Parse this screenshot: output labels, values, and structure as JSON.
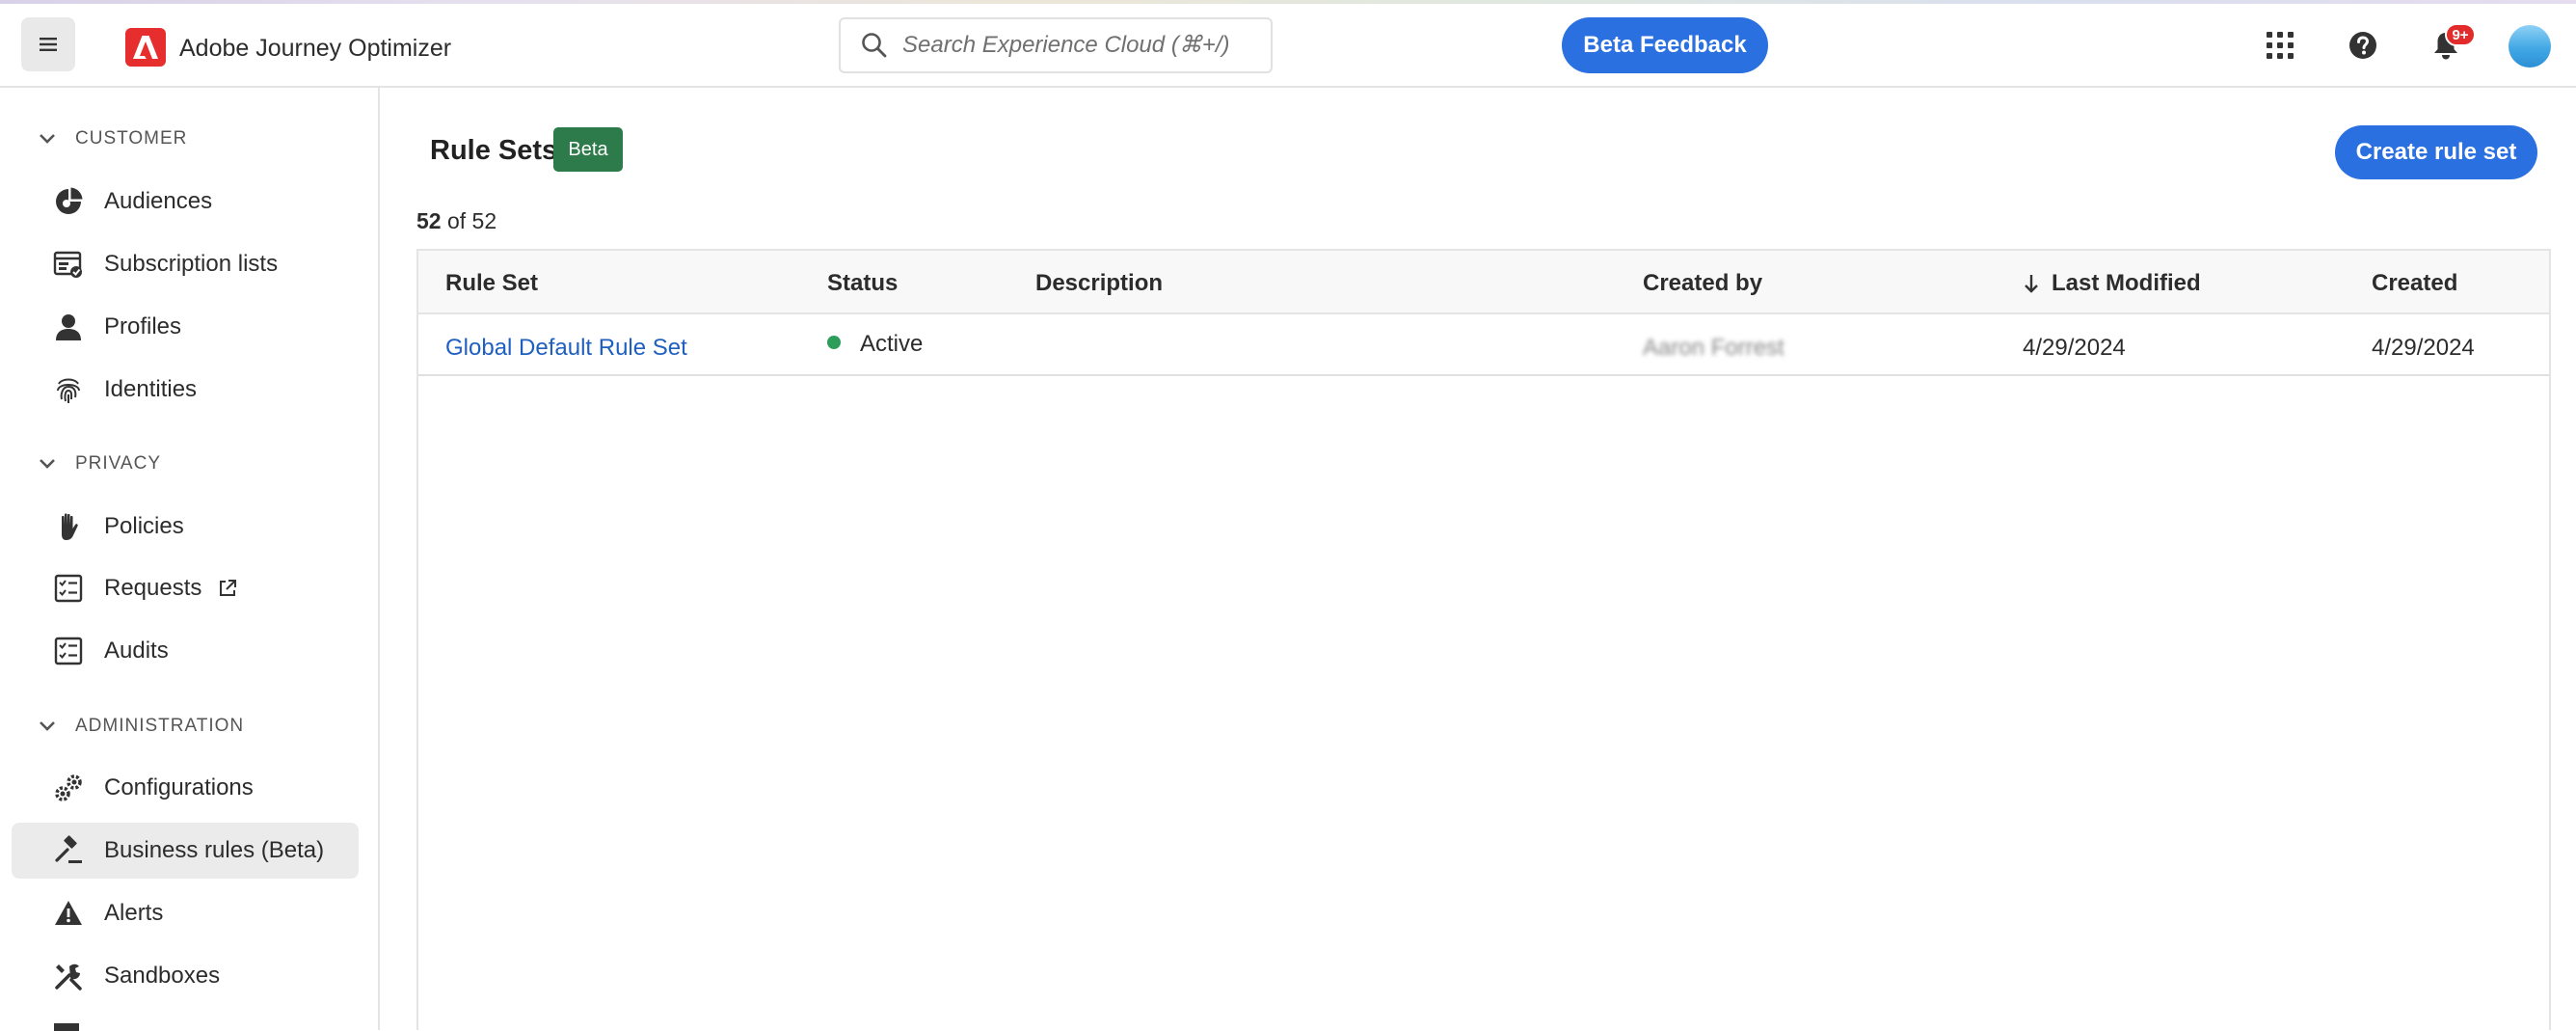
{
  "header": {
    "app_title": "Adobe Journey Optimizer",
    "search_placeholder": "Search Experience Cloud (⌘+/)",
    "beta_feedback": "Beta Feedback",
    "notification_count": "9+"
  },
  "sidebar": {
    "sections": [
      {
        "title": "CUSTOMER",
        "items": [
          {
            "label": "Audiences",
            "icon": "audiences-icon"
          },
          {
            "label": "Subscription lists",
            "icon": "subscription-list-icon"
          },
          {
            "label": "Profiles",
            "icon": "user-icon"
          },
          {
            "label": "Identities",
            "icon": "fingerprint-icon"
          }
        ]
      },
      {
        "title": "PRIVACY",
        "items": [
          {
            "label": "Policies",
            "icon": "hand-icon"
          },
          {
            "label": "Requests",
            "icon": "checklist-icon",
            "external": true
          },
          {
            "label": "Audits",
            "icon": "checklist-icon"
          }
        ]
      },
      {
        "title": "ADMINISTRATION",
        "items": [
          {
            "label": "Configurations",
            "icon": "gears-icon"
          },
          {
            "label": "Business rules (Beta)",
            "icon": "gavel-icon",
            "active": true
          },
          {
            "label": "Alerts",
            "icon": "alert-icon"
          },
          {
            "label": "Sandboxes",
            "icon": "tools-icon"
          }
        ]
      }
    ]
  },
  "main": {
    "title": "Rule Sets",
    "badge": "Beta",
    "create_button": "Create rule set",
    "count_shown": "52",
    "count_total": "of 52",
    "table": {
      "columns": [
        "Rule Set",
        "Status",
        "Description",
        "Created by",
        "Last Modified",
        "Created"
      ],
      "sorted_column": "Last Modified",
      "rows": [
        {
          "rule_set": "Global Default Rule Set",
          "status": "Active",
          "description": "",
          "created_by": "Aaron Forrest",
          "last_modified": "4/29/2024",
          "created": "4/29/2024"
        }
      ]
    }
  },
  "colors": {
    "accent": "#2b70e0",
    "beta_badge": "#2d7b4a",
    "status_active": "#2d9d5a",
    "adobe_red": "#e62e2e",
    "link": "#1f5fbf"
  }
}
